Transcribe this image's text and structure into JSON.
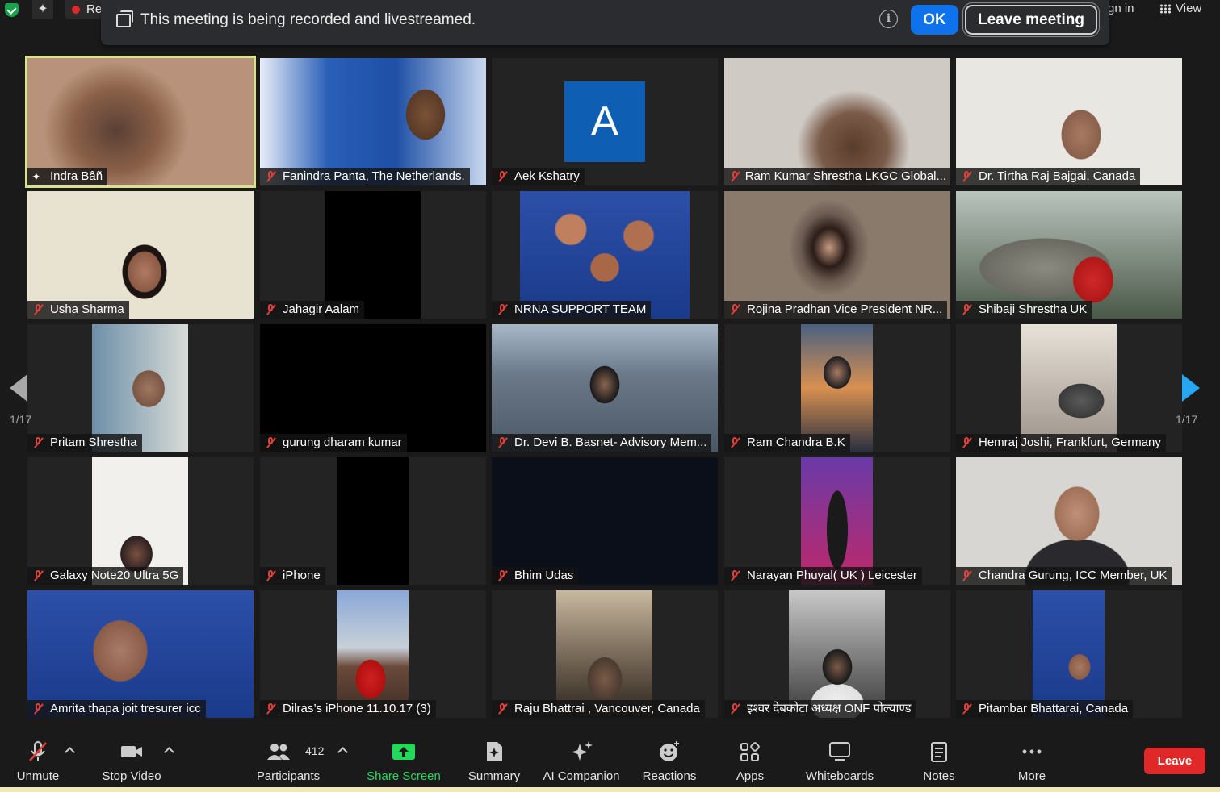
{
  "top": {
    "recording_label": "Re",
    "signin_label": "gn in",
    "view_label": "View"
  },
  "banner": {
    "message": "This meeting is being recorded and livestreamed.",
    "info": "i",
    "ok_label": "OK",
    "leave_meeting_label": "Leave meeting"
  },
  "tiles": [
    {
      "name": "Indra Bâñ",
      "mic": "pin",
      "active": true,
      "avatar": ""
    },
    {
      "name": "Fanindra Panta, The Netherlands.",
      "mic": "muted",
      "active": false,
      "avatar": ""
    },
    {
      "name": "Aek Kshatry",
      "mic": "muted",
      "active": false,
      "avatar": "A"
    },
    {
      "name": "Ram Kumar Shrestha LKGC Global...",
      "mic": "muted",
      "active": false,
      "avatar": ""
    },
    {
      "name": "Dr. Tirtha Raj Bajgai, Canada",
      "mic": "muted",
      "active": false,
      "avatar": ""
    },
    {
      "name": "Usha Sharma",
      "mic": "muted",
      "active": false,
      "avatar": ""
    },
    {
      "name": "Jahagir Aalam",
      "mic": "muted",
      "active": false,
      "avatar": ""
    },
    {
      "name": "NRNA SUPPORT TEAM",
      "mic": "muted",
      "active": false,
      "avatar": ""
    },
    {
      "name": "Rojina Pradhan Vice President NR...",
      "mic": "muted",
      "active": false,
      "avatar": ""
    },
    {
      "name": "Shibaji Shrestha UK",
      "mic": "muted",
      "active": false,
      "avatar": ""
    },
    {
      "name": "Pritam Shrestha",
      "mic": "muted",
      "active": false,
      "avatar": ""
    },
    {
      "name": "gurung dharam kumar",
      "mic": "muted",
      "active": false,
      "avatar": ""
    },
    {
      "name": "Dr. Devi B. Basnet- Advisory Mem...",
      "mic": "muted",
      "active": false,
      "avatar": ""
    },
    {
      "name": "Ram Chandra B.K",
      "mic": "muted",
      "active": false,
      "avatar": ""
    },
    {
      "name": "Hemraj Joshi, Frankfurt, Germany",
      "mic": "muted",
      "active": false,
      "avatar": ""
    },
    {
      "name": "Galaxy Note20 Ultra 5G",
      "mic": "muted",
      "active": false,
      "avatar": ""
    },
    {
      "name": "iPhone",
      "mic": "muted",
      "active": false,
      "avatar": ""
    },
    {
      "name": "Bhim Udas",
      "mic": "muted",
      "active": false,
      "avatar": ""
    },
    {
      "name": "Narayan Phuyal( UK ) Leicester",
      "mic": "muted",
      "active": false,
      "avatar": ""
    },
    {
      "name": "Chandra Gurung, ICC Member, UK",
      "mic": "muted",
      "active": false,
      "avatar": ""
    },
    {
      "name": "Amrita thapa joit tresurer icc",
      "mic": "muted",
      "active": false,
      "avatar": ""
    },
    {
      "name": "Dilras’s iPhone 11.10.17 (3)",
      "mic": "muted",
      "active": false,
      "avatar": ""
    },
    {
      "name": "Raju Bhattrai , Vancouver,  Canada",
      "mic": "muted",
      "active": false,
      "avatar": ""
    },
    {
      "name": "इश्वर देबकोटा अध्यक्ष ONF पोल्याण्ड",
      "mic": "muted",
      "active": false,
      "avatar": ""
    },
    {
      "name": "Pitambar Bhattarai, Canada",
      "mic": "muted",
      "active": false,
      "avatar": ""
    }
  ],
  "pager": {
    "left": "1/17",
    "right": "1/17"
  },
  "toolbar": {
    "unmute": "Unmute",
    "stop_video": "Stop Video",
    "participants": "Participants",
    "participant_count": "412",
    "share_screen": "Share Screen",
    "summary": "Summary",
    "ai_companion": "AI Companion",
    "reactions": "Reactions",
    "apps": "Apps",
    "whiteboards": "Whiteboards",
    "notes": "Notes",
    "more": "More",
    "leave": "Leave"
  },
  "colors": {
    "accent_blue": "#0e72ed",
    "leave_red": "#e02828",
    "share_green": "#23d959",
    "active_speaker": "#d8e38a"
  }
}
